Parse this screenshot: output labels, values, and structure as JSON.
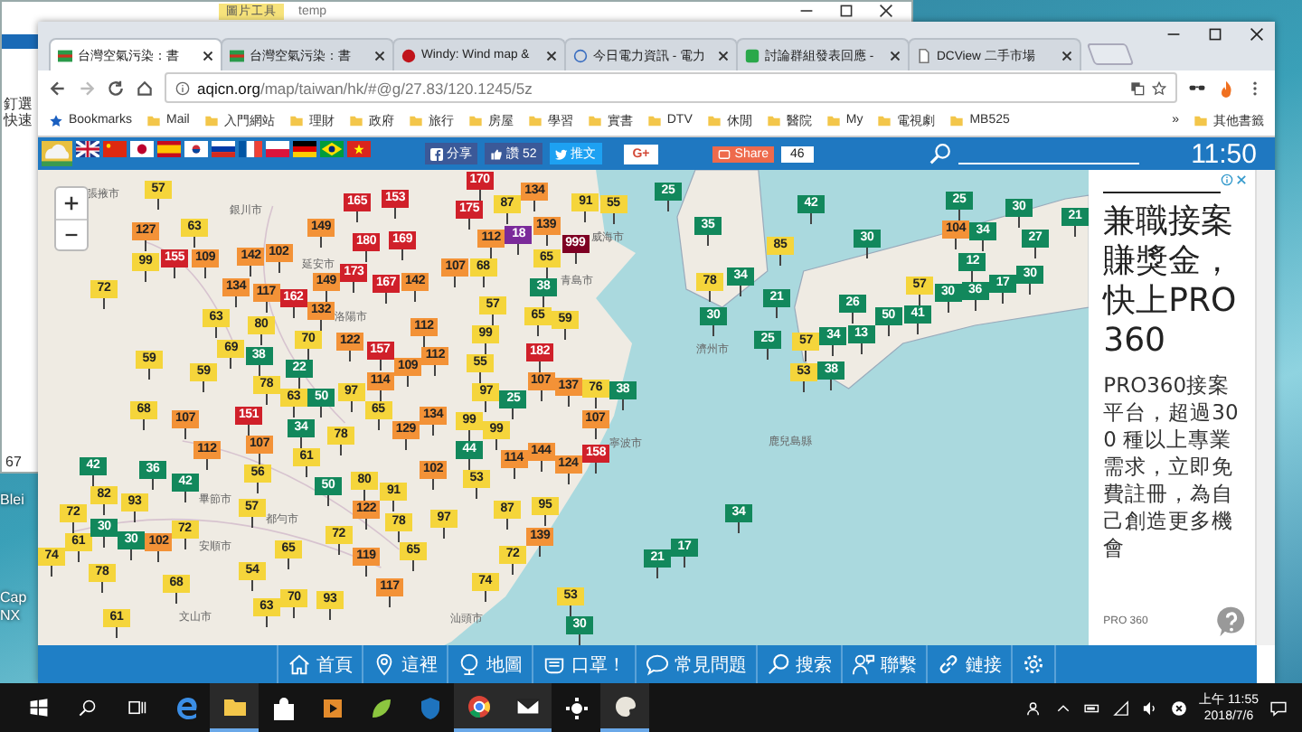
{
  "explorer": {
    "ribbon_tab": "圖片工具",
    "title": "temp",
    "sidebar_text": "釘選快速",
    "item_text": "67"
  },
  "desktop_icons": [
    {
      "label": "Blei"
    },
    {
      "label": "Cap NX"
    }
  ],
  "tabs": [
    {
      "title": "台灣空氣污染：書",
      "kind": "aqicn",
      "selected": true
    },
    {
      "title": "台灣空氣污染：書",
      "kind": "aqicn",
      "selected": false
    },
    {
      "title": "Windy: Wind map &",
      "kind": "windy",
      "selected": false
    },
    {
      "title": "今日電力資訊 - 電力",
      "kind": "power",
      "selected": false
    },
    {
      "title": "討論群組發表回應 -",
      "kind": "group",
      "selected": false
    },
    {
      "title": "DCView 二手市場",
      "kind": "doc",
      "selected": false
    }
  ],
  "address": {
    "domain": "aqicn.org",
    "path": "/map/taiwan/hk/#@g/27.83/120.1245/5z"
  },
  "bookmarks": [
    {
      "label": "Bookmarks",
      "kind": "star"
    },
    {
      "label": "Mail",
      "kind": "folder"
    },
    {
      "label": "入門網站",
      "kind": "folder"
    },
    {
      "label": "理財",
      "kind": "folder"
    },
    {
      "label": "政府",
      "kind": "folder"
    },
    {
      "label": "旅行",
      "kind": "folder"
    },
    {
      "label": "房屋",
      "kind": "folder"
    },
    {
      "label": "學習",
      "kind": "folder"
    },
    {
      "label": "實書",
      "kind": "folder"
    },
    {
      "label": "DTV",
      "kind": "folder"
    },
    {
      "label": "休閒",
      "kind": "folder"
    },
    {
      "label": "醫院",
      "kind": "folder"
    },
    {
      "label": "My",
      "kind": "folder"
    },
    {
      "label": "電視劇",
      "kind": "folder"
    },
    {
      "label": "MB525",
      "kind": "folder"
    }
  ],
  "bookmarks_more": "»",
  "other_bookmarks": "其他書籤",
  "flags": [
    {
      "kind": "logo"
    },
    {
      "kind": "uk"
    },
    {
      "kind": "cn"
    },
    {
      "kind": "jp"
    },
    {
      "kind": "es"
    },
    {
      "kind": "kr"
    },
    {
      "kind": "ru"
    },
    {
      "kind": "fr"
    },
    {
      "kind": "pl"
    },
    {
      "kind": "de"
    },
    {
      "kind": "br"
    },
    {
      "kind": "vn"
    }
  ],
  "social": {
    "fb_share": "分享",
    "like": "讚 52",
    "tweet": "推文",
    "gplus": "G+",
    "share": "Share",
    "share_count": "46"
  },
  "clock": "11:50",
  "markers": [
    {
      "value": "57",
      "color": "#f5d53b"
    },
    {
      "value": "170",
      "color": "#d0202a"
    },
    {
      "value": "134",
      "color": "#f39237"
    },
    {
      "value": "25",
      "color": "#12885c"
    },
    {
      "value": "165",
      "color": "#d0202a"
    },
    {
      "value": "153",
      "color": "#d0202a"
    },
    {
      "value": "175",
      "color": "#d0202a"
    },
    {
      "value": "87",
      "color": "#f5d53b"
    },
    {
      "value": "91",
      "color": "#f5d53b"
    },
    {
      "value": "55",
      "color": "#f5d53b"
    },
    {
      "value": "42",
      "color": "#12885c"
    },
    {
      "value": "25",
      "color": "#12885c"
    },
    {
      "value": "30",
      "color": "#12885c"
    },
    {
      "value": "63",
      "color": "#f5d53b"
    },
    {
      "value": "149",
      "color": "#f39237"
    },
    {
      "value": "139",
      "color": "#f39237"
    },
    {
      "value": "35",
      "color": "#12885c"
    },
    {
      "value": "104",
      "color": "#f39237"
    },
    {
      "value": "21",
      "color": "#12885c"
    },
    {
      "value": "127",
      "color": "#f39237"
    },
    {
      "value": "180",
      "color": "#d0202a"
    },
    {
      "value": "169",
      "color": "#d0202a"
    },
    {
      "value": "112",
      "color": "#f39237"
    },
    {
      "value": "18",
      "color": "#7b2a9a"
    },
    {
      "value": "999",
      "color": "#7e0023"
    },
    {
      "value": "85",
      "color": "#f5d53b"
    },
    {
      "value": "30",
      "color": "#12885c"
    },
    {
      "value": "34",
      "color": "#12885c"
    },
    {
      "value": "27",
      "color": "#12885c"
    },
    {
      "value": "99",
      "color": "#f5d53b"
    },
    {
      "value": "155",
      "color": "#d0202a"
    },
    {
      "value": "109",
      "color": "#f39237"
    },
    {
      "value": "142",
      "color": "#f39237"
    },
    {
      "value": "102",
      "color": "#f39237"
    },
    {
      "value": "107",
      "color": "#f39237"
    },
    {
      "value": "68",
      "color": "#f5d53b"
    },
    {
      "value": "65",
      "color": "#f5d53b"
    },
    {
      "value": "12",
      "color": "#12885c"
    },
    {
      "value": "134",
      "color": "#f39237"
    },
    {
      "value": "173",
      "color": "#d0202a"
    },
    {
      "value": "167",
      "color": "#d0202a"
    },
    {
      "value": "142",
      "color": "#f39237"
    },
    {
      "value": "38",
      "color": "#12885c"
    },
    {
      "value": "78",
      "color": "#f5d53b"
    },
    {
      "value": "34",
      "color": "#12885c"
    },
    {
      "value": "36",
      "color": "#12885c"
    },
    {
      "value": "17",
      "color": "#12885c"
    },
    {
      "value": "30",
      "color": "#12885c"
    },
    {
      "value": "72",
      "color": "#f5d53b"
    },
    {
      "value": "117",
      "color": "#f39237"
    },
    {
      "value": "162",
      "color": "#d0202a"
    },
    {
      "value": "149",
      "color": "#f39237"
    },
    {
      "value": "21",
      "color": "#12885c"
    },
    {
      "value": "57",
      "color": "#f5d53b"
    },
    {
      "value": "30",
      "color": "#12885c"
    },
    {
      "value": "63",
      "color": "#f5d53b"
    },
    {
      "value": "132",
      "color": "#f39237"
    },
    {
      "value": "57",
      "color": "#f5d53b"
    },
    {
      "value": "65",
      "color": "#f5d53b"
    },
    {
      "value": "59",
      "color": "#f5d53b"
    },
    {
      "value": "30",
      "color": "#12885c"
    },
    {
      "value": "26",
      "color": "#12885c"
    },
    {
      "value": "50",
      "color": "#12885c"
    },
    {
      "value": "41",
      "color": "#12885c"
    },
    {
      "value": "80",
      "color": "#f5d53b"
    },
    {
      "value": "70",
      "color": "#f5d53b"
    },
    {
      "value": "112",
      "color": "#f39237"
    },
    {
      "value": "99",
      "color": "#f5d53b"
    },
    {
      "value": "25",
      "color": "#12885c"
    },
    {
      "value": "34",
      "color": "#12885c"
    },
    {
      "value": "13",
      "color": "#12885c"
    },
    {
      "value": "69",
      "color": "#f5d53b"
    },
    {
      "value": "122",
      "color": "#f39237"
    },
    {
      "value": "157",
      "color": "#d0202a"
    },
    {
      "value": "112",
      "color": "#f39237"
    },
    {
      "value": "182",
      "color": "#d0202a"
    },
    {
      "value": "57",
      "color": "#f5d53b"
    },
    {
      "value": "59",
      "color": "#f5d53b"
    },
    {
      "value": "59",
      "color": "#f5d53b"
    },
    {
      "value": "38",
      "color": "#12885c"
    },
    {
      "value": "22",
      "color": "#12885c"
    },
    {
      "value": "109",
      "color": "#f39237"
    },
    {
      "value": "55",
      "color": "#f5d53b"
    },
    {
      "value": "107",
      "color": "#f39237"
    },
    {
      "value": "53",
      "color": "#f5d53b"
    },
    {
      "value": "38",
      "color": "#12885c"
    },
    {
      "value": "78",
      "color": "#f5d53b"
    },
    {
      "value": "63",
      "color": "#f5d53b"
    },
    {
      "value": "50",
      "color": "#12885c"
    },
    {
      "value": "97",
      "color": "#f5d53b"
    },
    {
      "value": "114",
      "color": "#f39237"
    },
    {
      "value": "137",
      "color": "#f39237"
    },
    {
      "value": "76",
      "color": "#f5d53b"
    },
    {
      "value": "38",
      "color": "#12885c"
    },
    {
      "value": "68",
      "color": "#f5d53b"
    },
    {
      "value": "65",
      "color": "#f5d53b"
    },
    {
      "value": "97",
      "color": "#f5d53b"
    },
    {
      "value": "25",
      "color": "#12885c"
    },
    {
      "value": "107",
      "color": "#f39237"
    },
    {
      "value": "151",
      "color": "#d0202a"
    },
    {
      "value": "34",
      "color": "#12885c"
    },
    {
      "value": "129",
      "color": "#f39237"
    },
    {
      "value": "134",
      "color": "#f39237"
    },
    {
      "value": "99",
      "color": "#f5d53b"
    },
    {
      "value": "99",
      "color": "#f5d53b"
    },
    {
      "value": "107",
      "color": "#f39237"
    },
    {
      "value": "112",
      "color": "#f39237"
    },
    {
      "value": "107",
      "color": "#f39237"
    },
    {
      "value": "78",
      "color": "#f5d53b"
    },
    {
      "value": "44",
      "color": "#12885c"
    },
    {
      "value": "61",
      "color": "#f5d53b"
    },
    {
      "value": "53",
      "color": "#f5d53b"
    },
    {
      "value": "114",
      "color": "#f39237"
    },
    {
      "value": "144",
      "color": "#f39237"
    },
    {
      "value": "124",
      "color": "#f39237"
    },
    {
      "value": "158",
      "color": "#d0202a"
    },
    {
      "value": "42",
      "color": "#12885c"
    },
    {
      "value": "36",
      "color": "#12885c"
    },
    {
      "value": "42",
      "color": "#12885c"
    },
    {
      "value": "56",
      "color": "#f5d53b"
    },
    {
      "value": "50",
      "color": "#12885c"
    },
    {
      "value": "80",
      "color": "#f5d53b"
    },
    {
      "value": "102",
      "color": "#f39237"
    },
    {
      "value": "82",
      "color": "#f5d53b"
    },
    {
      "value": "93",
      "color": "#f5d53b"
    },
    {
      "value": "91",
      "color": "#f5d53b"
    },
    {
      "value": "72",
      "color": "#f5d53b"
    },
    {
      "value": "57",
      "color": "#f5d53b"
    },
    {
      "value": "122",
      "color": "#f39237"
    },
    {
      "value": "78",
      "color": "#f5d53b"
    },
    {
      "value": "97",
      "color": "#f5d53b"
    },
    {
      "value": "87",
      "color": "#f5d53b"
    },
    {
      "value": "95",
      "color": "#f5d53b"
    },
    {
      "value": "34",
      "color": "#12885c"
    },
    {
      "value": "61",
      "color": "#f5d53b"
    },
    {
      "value": "30",
      "color": "#12885c"
    },
    {
      "value": "72",
      "color": "#f5d53b"
    },
    {
      "value": "72",
      "color": "#f5d53b"
    },
    {
      "value": "139",
      "color": "#f39237"
    },
    {
      "value": "74",
      "color": "#f5d53b"
    },
    {
      "value": "30",
      "color": "#12885c"
    },
    {
      "value": "102",
      "color": "#f39237"
    },
    {
      "value": "65",
      "color": "#f5d53b"
    },
    {
      "value": "119",
      "color": "#f39237"
    },
    {
      "value": "65",
      "color": "#f5d53b"
    },
    {
      "value": "72",
      "color": "#f5d53b"
    },
    {
      "value": "17",
      "color": "#12885c"
    },
    {
      "value": "78",
      "color": "#f5d53b"
    },
    {
      "value": "54",
      "color": "#f5d53b"
    },
    {
      "value": "21",
      "color": "#12885c"
    },
    {
      "value": "68",
      "color": "#f5d53b"
    },
    {
      "value": "117",
      "color": "#f39237"
    },
    {
      "value": "74",
      "color": "#f5d53b"
    },
    {
      "value": "63",
      "color": "#f5d53b"
    },
    {
      "value": "70",
      "color": "#f5d53b"
    },
    {
      "value": "93",
      "color": "#f5d53b"
    },
    {
      "value": "53",
      "color": "#f5d53b"
    },
    {
      "value": "61",
      "color": "#f5d53b"
    },
    {
      "value": "30",
      "color": "#12885c"
    }
  ],
  "map_labels": [
    "張掖市",
    "銀川市",
    "延安市",
    "洛陽市",
    "青島市",
    "威海市",
    "畢節市",
    "安順市",
    "都勻市",
    "文山市",
    "寧波市",
    "汕頭市",
    "濟州市",
    "鹿兒島縣"
  ],
  "ad": {
    "title": "兼職接案賺獎金，快上PRO360",
    "body": "PRO360接案平台，超過300 種以上專業需求，立即免費註冊，為自己創造更多機會",
    "brand": "PRO 360"
  },
  "nav": [
    {
      "label": "首頁",
      "kind": "home"
    },
    {
      "label": "這裡",
      "kind": "pin"
    },
    {
      "label": "地圖",
      "kind": "globe"
    },
    {
      "label": "口罩！",
      "kind": "mask"
    },
    {
      "label": "常見問題",
      "kind": "chat"
    },
    {
      "label": "搜索",
      "kind": "search"
    },
    {
      "label": "聯繫",
      "kind": "contact"
    },
    {
      "label": "鏈接",
      "kind": "link"
    }
  ],
  "taskbar_apps": [
    {
      "kind": "edge",
      "running": false
    },
    {
      "kind": "folder",
      "running": true
    },
    {
      "kind": "store",
      "running": false
    },
    {
      "kind": "media",
      "running": false
    },
    {
      "kind": "leaf",
      "running": false
    },
    {
      "kind": "shield",
      "running": false
    },
    {
      "kind": "chrome",
      "running": true
    },
    {
      "kind": "mail",
      "running": true
    },
    {
      "kind": "gear",
      "running": false
    },
    {
      "kind": "paint",
      "running": true
    }
  ],
  "tray": {
    "time": "上午 11:55",
    "date": "2018/7/6"
  }
}
